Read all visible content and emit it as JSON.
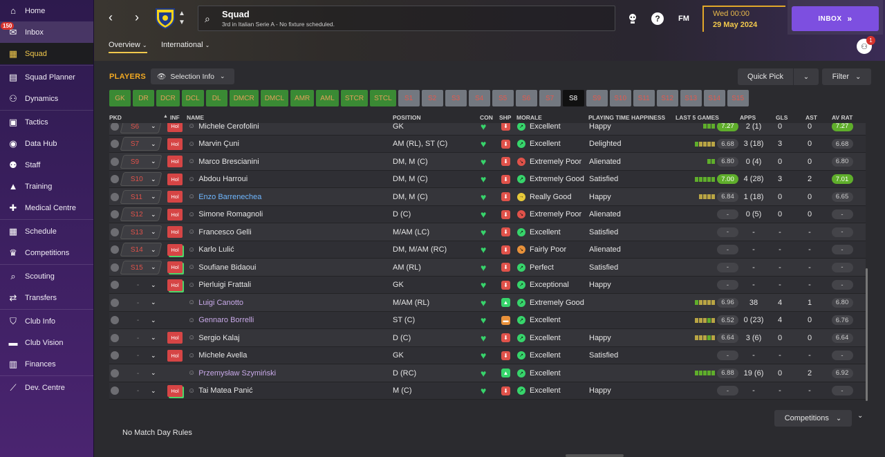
{
  "sidebar": {
    "items": [
      {
        "label": "Home",
        "icon": "home-icon",
        "glyph": "⌂"
      },
      {
        "label": "Inbox",
        "icon": "inbox-icon",
        "glyph": "✉",
        "badge": "150"
      },
      {
        "label": "Squad",
        "icon": "squad-icon",
        "glyph": "▦",
        "active": true
      },
      {
        "label": "Squad Planner",
        "icon": "planner-icon",
        "glyph": "▤"
      },
      {
        "label": "Dynamics",
        "icon": "dynamics-icon",
        "glyph": "⚇"
      },
      {
        "label": "Tactics",
        "icon": "tactics-icon",
        "glyph": "▣"
      },
      {
        "label": "Data Hub",
        "icon": "data-hub-icon",
        "glyph": "◉"
      },
      {
        "label": "Staff",
        "icon": "staff-icon",
        "glyph": "⚉"
      },
      {
        "label": "Training",
        "icon": "training-icon",
        "glyph": "▲"
      },
      {
        "label": "Medical Centre",
        "icon": "medical-icon",
        "glyph": "✚"
      },
      {
        "label": "Schedule",
        "icon": "schedule-icon",
        "glyph": "▦"
      },
      {
        "label": "Competitions",
        "icon": "trophy-icon",
        "glyph": "♛"
      },
      {
        "label": "Scouting",
        "icon": "scouting-icon",
        "glyph": "⌕"
      },
      {
        "label": "Transfers",
        "icon": "transfers-icon",
        "glyph": "⇄"
      },
      {
        "label": "Club Info",
        "icon": "club-info-icon",
        "glyph": "⛉"
      },
      {
        "label": "Club Vision",
        "icon": "club-vision-icon",
        "glyph": "▬"
      },
      {
        "label": "Finances",
        "icon": "finances-icon",
        "glyph": "▥"
      },
      {
        "label": "Dev. Centre",
        "icon": "dev-centre-icon",
        "glyph": "⟋"
      }
    ]
  },
  "header": {
    "title": "Squad",
    "subtitle": "3rd in Italian Serie A - No fixture scheduled.",
    "date_day": "Wed 00:00",
    "date_full": "29 May 2024",
    "inbox_label": "INBOX",
    "fm_label": "FM",
    "help_label": "?",
    "social_badge": "1",
    "tabs": [
      "Overview",
      "International"
    ]
  },
  "toolbar": {
    "players_label": "PLAYERS",
    "selection_info": "Selection Info",
    "quick_pick": "Quick Pick",
    "filter": "Filter",
    "positions": [
      "GK",
      "DR",
      "DCR",
      "DCL",
      "DL",
      "DMCR",
      "DMCL",
      "AMR",
      "AML",
      "STCR",
      "STCL",
      "S1",
      "S2",
      "S3",
      "S4",
      "S5",
      "S6",
      "S7",
      "S8",
      "S9",
      "S10",
      "S11",
      "S12",
      "S13",
      "S14",
      "S15"
    ],
    "current_position": "S8"
  },
  "table": {
    "headers": {
      "pkd": "PKD",
      "inf": "INF",
      "name": "NAME",
      "position": "POSITION",
      "con": "CON",
      "shp": "SHP",
      "morale": "MORALE",
      "pth": "PLAYING TIME HAPPINESS",
      "last5": "LAST 5 GAMES",
      "apps": "APPS",
      "gls": "GLS",
      "ast": "AST",
      "avrat": "AV RAT"
    },
    "rows": [
      {
        "sq": "S6",
        "inf": "Hol",
        "name": "Michele Cerofolini",
        "pos": "GK",
        "shp": "bad",
        "morale": "Excellent",
        "mtype": "up",
        "pth": "Happy",
        "form": 3,
        "fcolor": "green",
        "last": "7.27",
        "lasthi": true,
        "apps": "2 (1)",
        "gls": "0",
        "ast": "0",
        "av": "7.27",
        "avhi": true
      },
      {
        "sq": "S7",
        "inf": "Hol",
        "name": "Marvin Çuni",
        "pos": "AM (RL), ST (C)",
        "shp": "bad",
        "morale": "Excellent",
        "mtype": "up",
        "pth": "Delighted",
        "form": 5,
        "fcolor": "mix",
        "last": "6.68",
        "apps": "3 (18)",
        "gls": "3",
        "ast": "0",
        "av": "6.68"
      },
      {
        "sq": "S9",
        "inf": "Hol",
        "name": "Marco Brescianini",
        "pos": "DM, M (C)",
        "shp": "bad",
        "morale": "Extremely Poor",
        "mtype": "down",
        "pth": "Alienated",
        "form": 2,
        "fcolor": "green",
        "last": "6.80",
        "apps": "0 (4)",
        "gls": "0",
        "ast": "0",
        "av": "6.80"
      },
      {
        "sq": "S10",
        "inf": "Hol",
        "name": "Abdou Harroui",
        "pos": "DM, M (C)",
        "shp": "bad",
        "morale": "Extremely Good",
        "mtype": "up",
        "pth": "Satisfied",
        "form": 5,
        "fcolor": "green",
        "last": "7.00",
        "lasthi": true,
        "apps": "4 (28)",
        "gls": "3",
        "ast": "2",
        "av": "7.01",
        "avhi": true
      },
      {
        "sq": "S11",
        "inf": "Hol",
        "name": "Enzo Barrenechea",
        "name_style": "blue",
        "pos": "DM, M (C)",
        "shp": "bad",
        "morale": "Really Good",
        "mtype": "yellow",
        "pth": "Happy",
        "form": 4,
        "fcolor": "mix",
        "last": "6.84",
        "apps": "1 (18)",
        "gls": "0",
        "ast": "0",
        "av": "6.65"
      },
      {
        "sq": "S12",
        "inf": "Hol",
        "name": "Simone Romagnoli",
        "pos": "D (C)",
        "shp": "bad",
        "morale": "Extremely Poor",
        "mtype": "down",
        "pth": "Alienated",
        "form": 0,
        "last": "-",
        "apps": "0 (5)",
        "gls": "0",
        "ast": "0",
        "av": "-"
      },
      {
        "sq": "S13",
        "inf": "Hol",
        "name": "Francesco Gelli",
        "pos": "M/AM (LC)",
        "shp": "bad",
        "morale": "Excellent",
        "mtype": "up",
        "pth": "Satisfied",
        "form": 0,
        "last": "-",
        "apps": "-",
        "gls": "-",
        "ast": "-",
        "av": "-"
      },
      {
        "sq": "S14",
        "inf": "Hol",
        "infgreen": true,
        "name": "Karlo Lulić",
        "pos": "DM, M/AM (RC)",
        "shp": "bad",
        "morale": "Fairly Poor",
        "mtype": "orange",
        "pth": "Alienated",
        "form": 0,
        "last": "-",
        "apps": "-",
        "gls": "-",
        "ast": "-",
        "av": "-"
      },
      {
        "sq": "S15",
        "inf": "Hol",
        "infgreen": true,
        "name": "Soufiane Bidaoui",
        "pos": "AM (RL)",
        "shp": "bad",
        "morale": "Perfect",
        "mtype": "up",
        "pth": "Satisfied",
        "form": 0,
        "last": "-",
        "apps": "-",
        "gls": "-",
        "ast": "-",
        "av": "-"
      },
      {
        "sq": "-",
        "inf": "Hol",
        "infgreen": true,
        "name": "Pierluigi Frattali",
        "pos": "GK",
        "shp": "bad",
        "morale": "Exceptional",
        "mtype": "up",
        "pth": "Happy",
        "form": 0,
        "last": "-",
        "apps": "-",
        "gls": "-",
        "ast": "-",
        "av": "-"
      },
      {
        "sq": "-",
        "inf": "",
        "name": "Luigi Canotto",
        "name_style": "loan",
        "pos": "M/AM (RL)",
        "shp": "good",
        "morale": "Extremely Good",
        "mtype": "up",
        "pth": "",
        "form": 5,
        "fcolor": "mix",
        "last": "6.96",
        "apps": "38",
        "gls": "4",
        "ast": "1",
        "av": "6.80"
      },
      {
        "sq": "-",
        "inf": "",
        "name": "Gennaro Borrelli",
        "name_style": "loan",
        "pos": "ST (C)",
        "shp": "mid",
        "morale": "Excellent",
        "mtype": "up",
        "pth": "",
        "form": 5,
        "fcolor": "brown",
        "last": "6.52",
        "apps": "0 (23)",
        "gls": "4",
        "ast": "0",
        "av": "6.76"
      },
      {
        "sq": "-",
        "inf": "Hol",
        "name": "Sergio Kalaj",
        "pos": "D (C)",
        "shp": "bad",
        "morale": "Excellent",
        "mtype": "up",
        "pth": "Happy",
        "form": 5,
        "fcolor": "brown",
        "last": "6.64",
        "apps": "3 (6)",
        "gls": "0",
        "ast": "0",
        "av": "6.64"
      },
      {
        "sq": "-",
        "inf": "Hol",
        "name": "Michele Avella",
        "pos": "GK",
        "shp": "bad",
        "morale": "Excellent",
        "mtype": "up",
        "pth": "Satisfied",
        "form": 0,
        "last": "-",
        "apps": "-",
        "gls": "-",
        "ast": "-",
        "av": "-"
      },
      {
        "sq": "-",
        "inf": "",
        "name": "Przemysław Szymiński",
        "name_style": "loan",
        "pos": "D (RC)",
        "shp": "good",
        "morale": "Excellent",
        "mtype": "up",
        "pth": "",
        "form": 5,
        "fcolor": "green",
        "last": "6.88",
        "apps": "19 (6)",
        "gls": "0",
        "ast": "2",
        "av": "6.92"
      },
      {
        "sq": "-",
        "inf": "Hol",
        "infgreen": true,
        "name": "Tai Matea Panić",
        "pos": "M (C)",
        "shp": "bad",
        "morale": "Excellent",
        "mtype": "up",
        "pth": "Happy",
        "form": 0,
        "last": "-",
        "apps": "-",
        "gls": "-",
        "ast": "-",
        "av": "-"
      }
    ]
  },
  "footer": {
    "competitions": "Competitions",
    "match_day_rules": "No Match Day Rules"
  },
  "colors": {
    "accent": "#f2c94c",
    "inbox": "#7d4fe0",
    "positive": "#37d46b",
    "negative": "#e0524a",
    "highlight_rating": "#5fae2b"
  }
}
